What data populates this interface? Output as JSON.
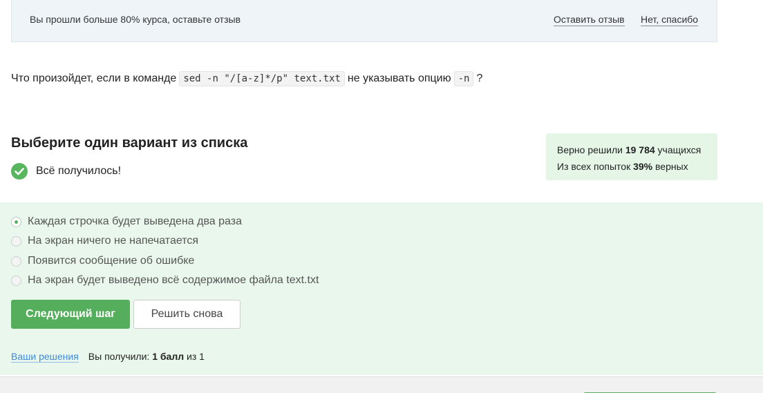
{
  "banner": {
    "text": "Вы прошли больше 80% курса, оставьте отзыв",
    "leave_review": "Оставить отзыв",
    "no_thanks": "Нет, спасибо"
  },
  "question": {
    "prefix": "Что произойдет, если в команде",
    "command": "sed -n \"/[a-z]*/p\" text.txt",
    "middle": "не указывать опцию",
    "option": "-n",
    "suffix": "?"
  },
  "section": {
    "title": "Выберите один вариант из списка",
    "success_text": "Всё получилось!"
  },
  "stats": {
    "solved_prefix": "Верно решили",
    "solved_count": "19 784",
    "solved_suffix": "учащихся",
    "attempts_prefix": "Из всех попыток",
    "attempts_percent": "39%",
    "attempts_suffix": "верных"
  },
  "options": [
    {
      "label": "Каждая строчка будет выведена два раза",
      "selected": true
    },
    {
      "label": "На экран ничего не напечатается",
      "selected": false
    },
    {
      "label": "Появится сообщение об ошибке",
      "selected": false
    },
    {
      "label": "На экран будет выведено всё содержимое файла text.txt",
      "selected": false
    }
  ],
  "buttons": {
    "next_step": "Следующий шаг",
    "solve_again": "Решить снова"
  },
  "footer": {
    "your_solutions": "Ваши решения",
    "score_prefix": "Вы получили:",
    "score_value": "1 балл",
    "score_suffix": "из 1"
  },
  "colors": {
    "accent_green": "#55ae5b",
    "answer_background": "#eaf7ec",
    "stats_background": "#e5f6e7",
    "banner_background": "#eef4f7",
    "link_blue": "#3f8ad8"
  },
  "icons": {
    "success": "check-circle-icon"
  }
}
